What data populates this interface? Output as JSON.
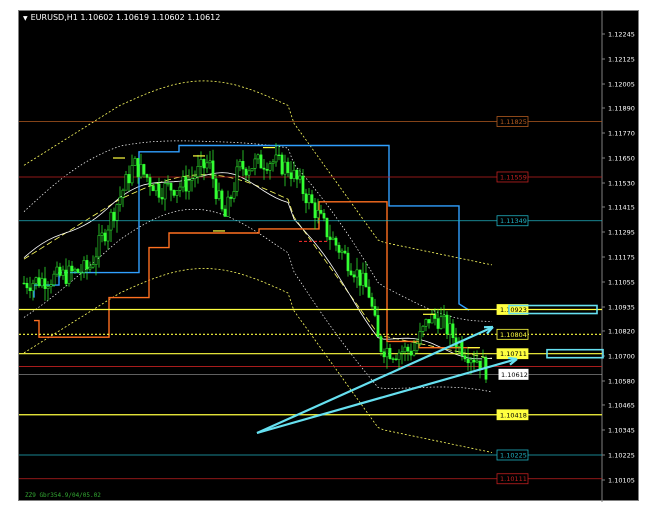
{
  "window": {
    "symbol_header": "EURUSD,H1  1.10602 1.10619 1.10602 1.10612",
    "footer_text": "ZZ9 Gbr354.9/04/05.02",
    "background": "#000000",
    "axis_text_color": "#ffffff"
  },
  "chart_data": {
    "type": "candlestick",
    "symbol": "EURUSD",
    "timeframe": "H1",
    "ohlc": {
      "open": 1.10602,
      "high": 1.10619,
      "low": 1.10602,
      "close": 1.10612
    },
    "price_axis": {
      "ticks": [
        "1.12245",
        "1.12125",
        "1.12005",
        "1.11890",
        "1.11770",
        "1.11650",
        "1.11530",
        "1.11415",
        "1.11295",
        "1.11175",
        "1.11055",
        "1.10935",
        "1.10820",
        "1.10700",
        "1.10580",
        "1.10465",
        "1.10345",
        "1.10225",
        "1.10105"
      ],
      "range": [
        1.1005,
        1.1231
      ]
    },
    "current_price": {
      "value": 1.10612,
      "label": "1.10612",
      "color": "#ffffff"
    },
    "levels": [
      {
        "value": 1.11825,
        "label": "1.11825",
        "color": "#b05a20",
        "style": "solid"
      },
      {
        "value": 1.11559,
        "label": "1.11559",
        "color": "#c02020",
        "style": "solid"
      },
      {
        "value": 1.11349,
        "label": "1.11349",
        "color": "#20b0c0",
        "style": "solid"
      },
      {
        "value": 1.10923,
        "label": "1.10923",
        "color": "#ffff40",
        "style": "solid"
      },
      {
        "value": 1.10804,
        "label": "1.10804",
        "color": "#ffff40",
        "style": "dotted"
      },
      {
        "value": 1.10711,
        "label": "1.10711",
        "color": "#ffff40",
        "style": "solid"
      },
      {
        "value": 1.10418,
        "label": "1.10418",
        "color": "#ffff40",
        "style": "solid"
      },
      {
        "value": 1.10225,
        "label": "1.10225",
        "color": "#20b0c0",
        "style": "solid"
      },
      {
        "value": 1.10111,
        "label": "1.10111",
        "color": "#c02020",
        "style": "solid"
      }
    ],
    "colors": {
      "bull_candle": "#33ff33",
      "bear_candle": "#33ff33",
      "blue_channel": "#30a0ff",
      "orange_channel": "#ff7020",
      "moving_avg": "#ffffff",
      "bands": "#ffff60",
      "arrows": "#66e0f0"
    }
  }
}
